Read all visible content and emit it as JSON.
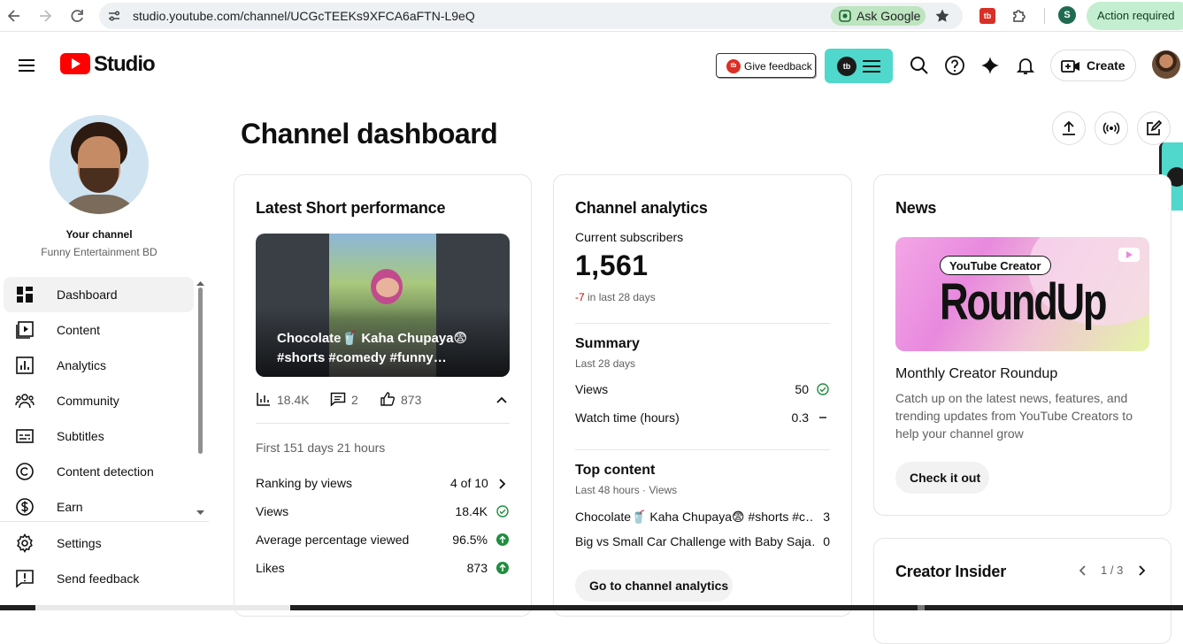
{
  "browser": {
    "url": "studio.youtube.com/channel/UCGcTEEKs9XFCA6aFTN-L9eQ",
    "ask_google": "Ask Google",
    "profile_initial": "S",
    "action_required": "Action required",
    "ext_label": "tb"
  },
  "header": {
    "logo_text": "Studio",
    "feedback_button": "Give feedback",
    "feedback_badge": "tb",
    "tb_badge": "tb",
    "create_button": "Create"
  },
  "sidebar": {
    "channel_title": "Your channel",
    "channel_name": "Funny Entertainment BD",
    "items": [
      {
        "label": "Dashboard",
        "icon": "dashboard-icon",
        "active": true
      },
      {
        "label": "Content",
        "icon": "content-icon"
      },
      {
        "label": "Analytics",
        "icon": "analytics-icon"
      },
      {
        "label": "Community",
        "icon": "community-icon"
      },
      {
        "label": "Subtitles",
        "icon": "subtitles-icon"
      },
      {
        "label": "Content detection",
        "icon": "copyright-icon"
      },
      {
        "label": "Earn",
        "icon": "dollar-icon"
      }
    ],
    "footer": [
      {
        "label": "Settings",
        "icon": "gear-icon"
      },
      {
        "label": "Send feedback",
        "icon": "feedback-icon"
      }
    ]
  },
  "main": {
    "title": "Channel dashboard",
    "short_card": {
      "heading": "Latest Short performance",
      "video_title": "Chocolate🥤 Kaha Chupaya😨 #shorts #comedy #funny…",
      "views_stat": "18.4K",
      "comments_stat": "2",
      "likes_stat": "873",
      "period": "First 151 days 21 hours",
      "rows": [
        {
          "label": "Ranking by views",
          "value": "4 of 10"
        },
        {
          "label": "Views",
          "value": "18.4K"
        },
        {
          "label": "Average percentage viewed",
          "value": "96.5%"
        },
        {
          "label": "Likes",
          "value": "873"
        }
      ]
    },
    "analytics_card": {
      "heading": "Channel analytics",
      "subs_label": "Current subscribers",
      "subs_value": "1,561",
      "subs_delta": "-7",
      "subs_delta_suffix": "in last 28 days",
      "summary_heading": "Summary",
      "summary_period": "Last 28 days",
      "summary_rows": [
        {
          "label": "Views",
          "value": "50"
        },
        {
          "label": "Watch time (hours)",
          "value": "0.3"
        }
      ],
      "top_heading": "Top content",
      "top_period": "Last 48 hours · Views",
      "top_rows": [
        {
          "label": "Chocolate🥤 Kaha Chupaya😨 #shorts #c…",
          "value": "3"
        },
        {
          "label": "Big vs Small Car Challenge with Baby Saja…",
          "value": "0"
        }
      ],
      "button": "Go to channel analytics"
    },
    "news_card": {
      "heading": "News",
      "image_tag": "YouTube Creator",
      "image_title": "RoundUp",
      "title": "Monthly Creator Roundup",
      "body": "Catch up on the latest news, features, and trending updates from YouTube Creators to help your channel grow",
      "button": "Check it out"
    },
    "insider_card": {
      "heading": "Creator Insider",
      "pager": "1 / 3"
    }
  },
  "colors": {
    "brand_red": "#ff0000",
    "tubebuddy_teal": "#4fd8cb",
    "positive_green": "#1e8e3e",
    "negative_red": "#cc0000"
  }
}
